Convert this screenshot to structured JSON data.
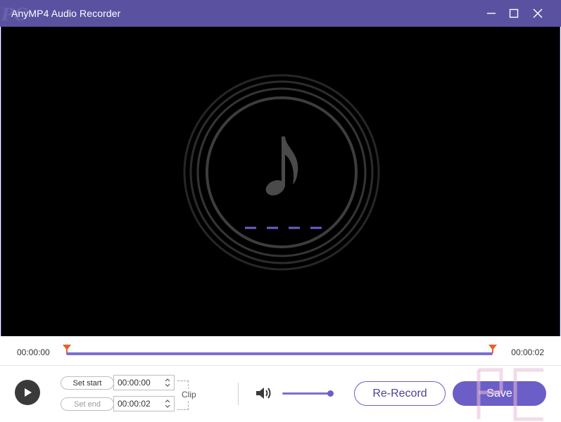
{
  "window": {
    "title": "AnyMP4 Audio Recorder",
    "watermark_text": "PC"
  },
  "icons": {
    "minimize": "minimize-icon",
    "maximize": "maximize-icon",
    "close": "close-icon",
    "music_note": "music-note-icon",
    "play": "play-icon",
    "volume": "speaker-icon"
  },
  "timeline": {
    "current_time": "00:00:00",
    "total_time": "00:00:02"
  },
  "clip": {
    "set_start_label": "Set start",
    "set_end_label": "Set end",
    "start_value": "00:00:00",
    "end_value": "00:00:02",
    "clip_label": "Clip"
  },
  "volume": {
    "level": 0.95
  },
  "actions": {
    "rerecord_label": "Re-Record",
    "save_label": "Save"
  },
  "colors": {
    "accent": "#6b5ec6",
    "titlebar": "#5a52a0",
    "marker": "#e8632b"
  }
}
